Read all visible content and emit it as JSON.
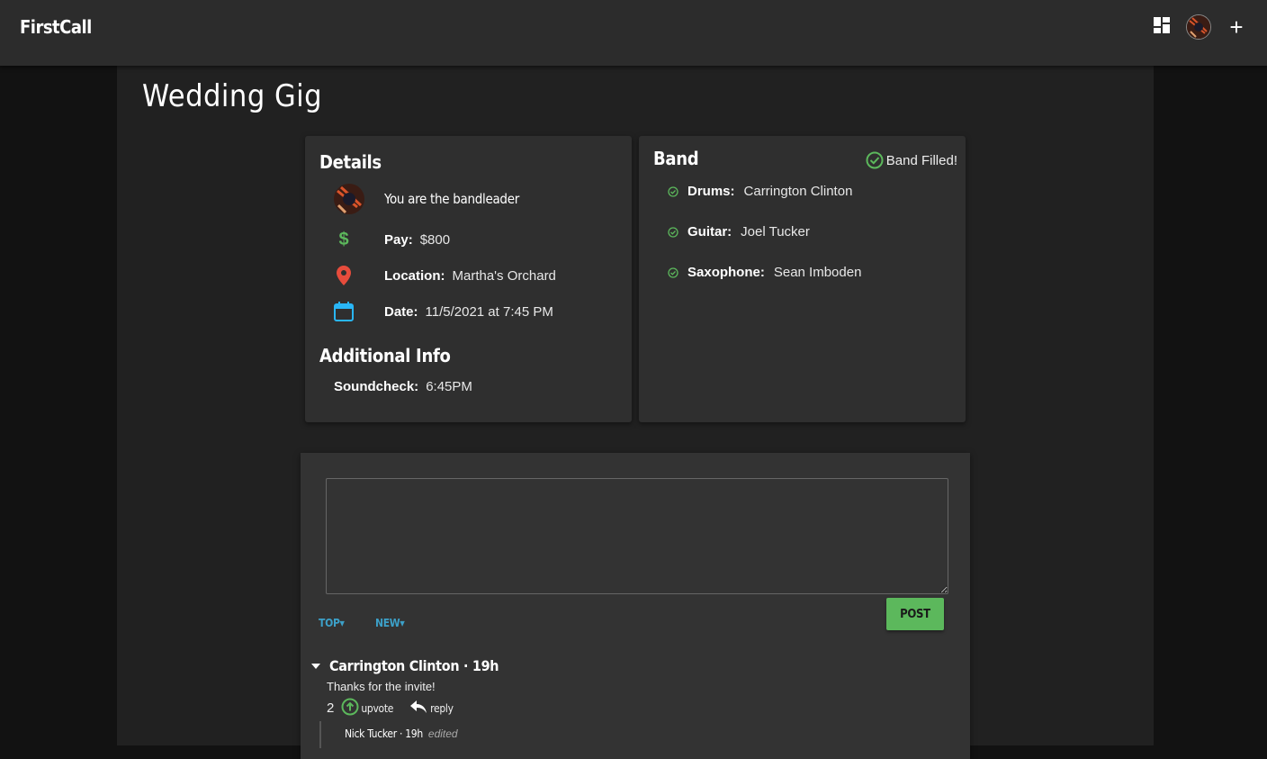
{
  "app": {
    "brand": "FirstCall"
  },
  "page": {
    "title": "Wedding Gig"
  },
  "details": {
    "heading": "Details",
    "bandleader_text": "You are the bandleader",
    "pay_label": "Pay:",
    "pay_value": "$800",
    "location_label": "Location:",
    "location_value": "Martha's Orchard",
    "date_label": "Date:",
    "date_value": "11/5/2021 at 7:45 PM",
    "additional_heading": "Additional Info",
    "soundcheck_label": "Soundcheck:",
    "soundcheck_value": "6:45PM"
  },
  "band": {
    "heading": "Band",
    "status": "Band Filled!",
    "members": [
      {
        "role": "Drums:",
        "name": "Carrington Clinton"
      },
      {
        "role": "Guitar:",
        "name": "Joel Tucker"
      },
      {
        "role": "Saxophone:",
        "name": "Sean Imboden"
      }
    ]
  },
  "comments": {
    "post_label": "POST",
    "sort_top": "TOP▾",
    "sort_new": "NEW▾",
    "items": [
      {
        "author_line": "Carrington Clinton · 19h",
        "text": "Thanks for the invite!",
        "votes": "2",
        "upvote_label": "upvote",
        "reply_label": "reply"
      }
    ],
    "reply": {
      "author_line": "Nick Tucker · 19h",
      "edited": "edited"
    }
  },
  "colors": {
    "accent_green": "#5cb85c",
    "accent_blue": "#3ca0c8",
    "pin_red": "#e74c3c",
    "calendar_blue": "#29b6f6"
  }
}
